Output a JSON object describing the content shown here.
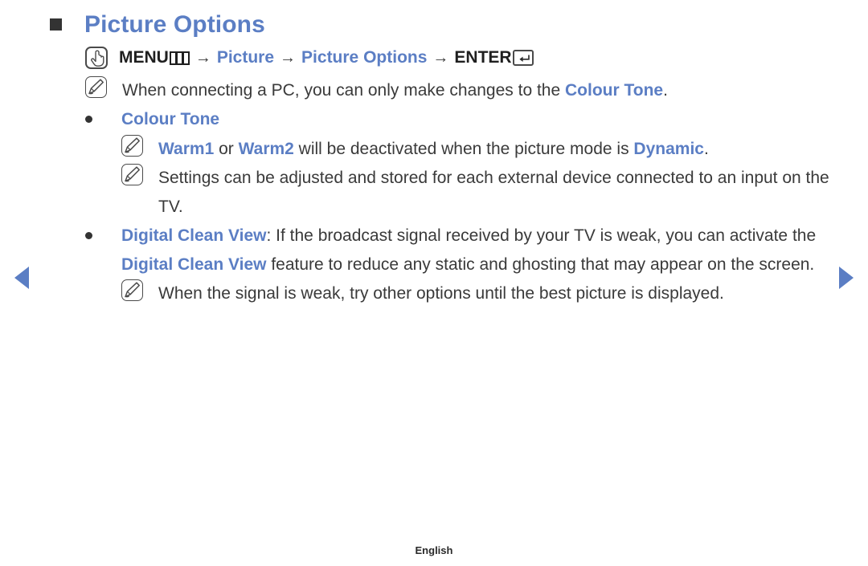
{
  "page": {
    "heading": "Picture Options",
    "footer_label": "English"
  },
  "nav": {
    "prev_label": "◀",
    "next_label": "▶"
  },
  "menu_path": {
    "press_icon": "hand-press-icon",
    "menu_label": "MENU",
    "menu_glyph": "menu-bars-icon",
    "arrow": "→",
    "step1": "Picture",
    "step2": "Picture Options",
    "enter_label": "ENTER",
    "enter_glyph": "enter-key-icon"
  },
  "notes": {
    "pc_note_pre": "When connecting a PC, you can only make changes to the ",
    "pc_note_link": "Colour Tone",
    "pc_note_post": "."
  },
  "sections": [
    {
      "title": "Colour Tone",
      "notes": [
        {
          "parts": [
            {
              "text": "Warm1",
              "style": "blue-b"
            },
            {
              "text": " or ",
              "style": "plain"
            },
            {
              "text": "Warm2",
              "style": "blue-b"
            },
            {
              "text": " will be deactivated when the picture mode is ",
              "style": "plain"
            },
            {
              "text": "Dynamic",
              "style": "blue-b"
            },
            {
              "text": ".",
              "style": "plain"
            }
          ]
        },
        {
          "parts": [
            {
              "text": "Settings can be adjusted and stored for each external device connected to an input on the TV.",
              "style": "plain"
            }
          ]
        }
      ]
    },
    {
      "title": "Digital Clean View",
      "body_pre": ": If the broadcast signal received by your TV is weak, you can activate the ",
      "body_link": "Digital Clean View",
      "body_post": " feature to reduce any static and ghosting that may appear on the screen.",
      "notes": [
        {
          "parts": [
            {
              "text": "When the signal is weak, try other options until the best picture is displayed.",
              "style": "plain"
            }
          ]
        }
      ]
    }
  ],
  "colors": {
    "accent_blue": "#5B7EC4",
    "text": "#3a3a3a",
    "marker": "#333333"
  }
}
